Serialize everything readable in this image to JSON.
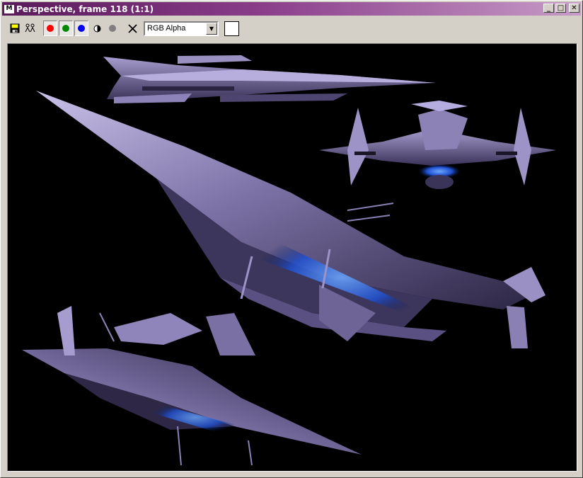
{
  "window": {
    "title": "Perspective, frame 118 (1:1)",
    "icon_label": "M",
    "minimize_label": "_",
    "maximize_label": "□",
    "close_label": "✕"
  },
  "toolbar": {
    "channel_select_value": "RGB Alpha",
    "red_color": "#ff0000",
    "green_color": "#008800",
    "blue_color": "#0000ee",
    "alpha_color": "#808080"
  },
  "viewport": {
    "background": "#000000",
    "content": "spaceship-renders",
    "hull_color": "#7a6f9e",
    "engine_glow_color": "#2a6cff"
  }
}
